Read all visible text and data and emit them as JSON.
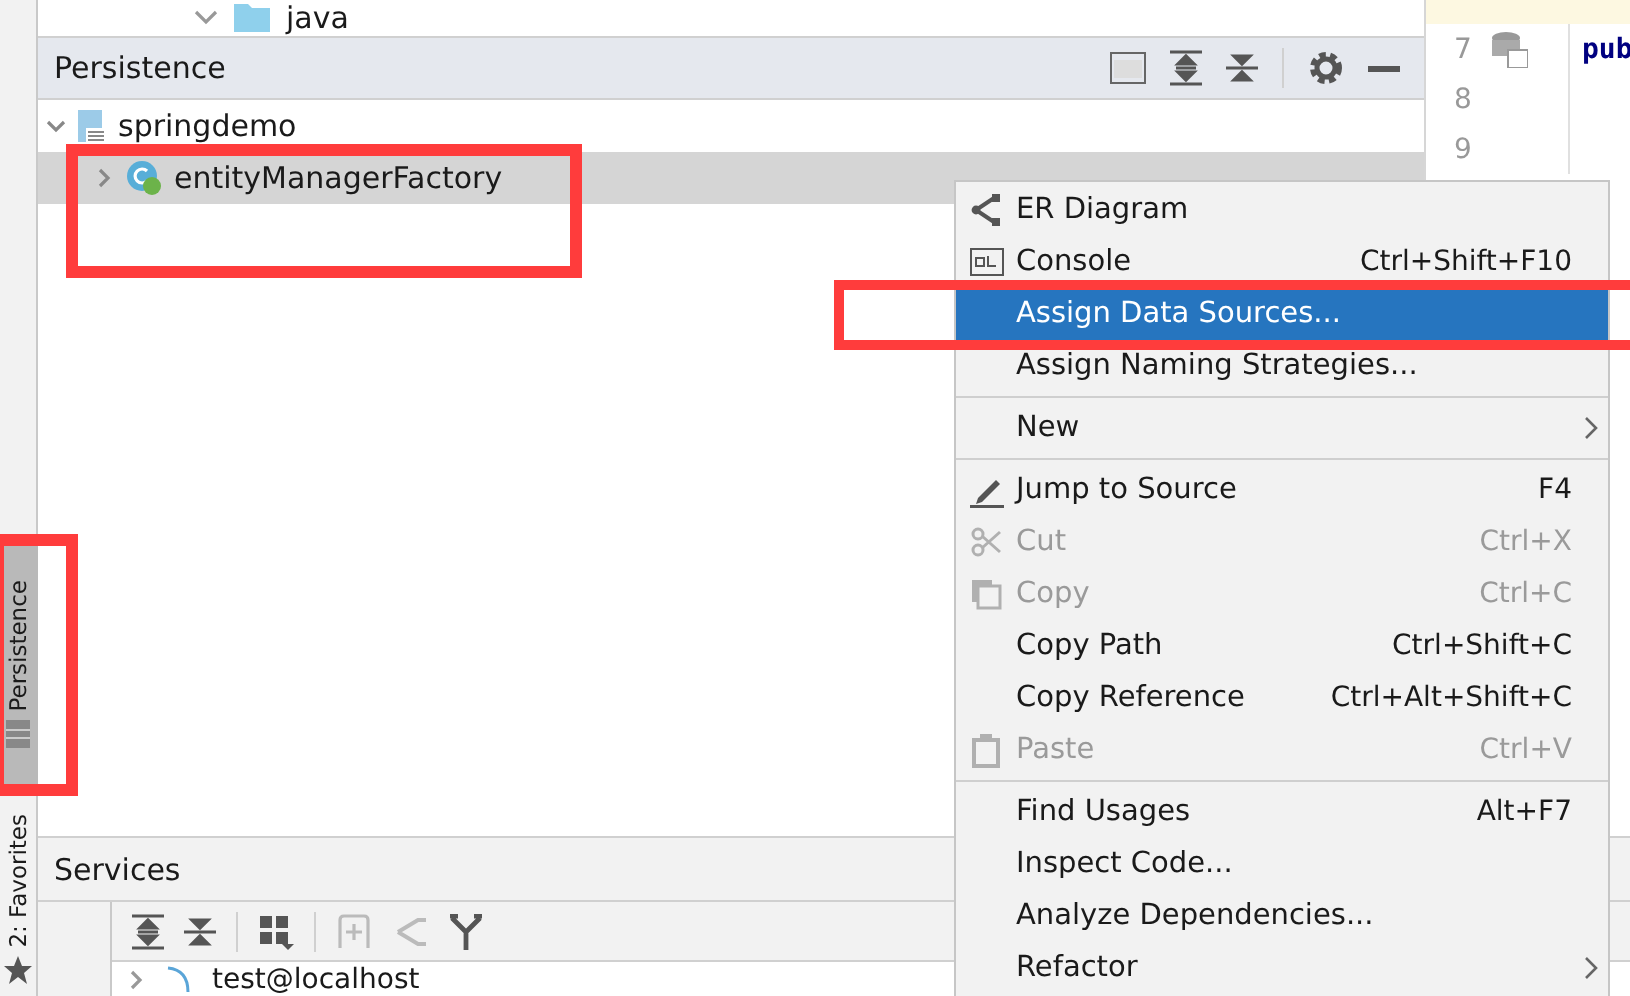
{
  "project_tree": {
    "folder": "java"
  },
  "persistence": {
    "title": "Persistence",
    "tree": [
      {
        "label": "springdemo",
        "expanded": true,
        "selected": false,
        "children": [
          {
            "label": "entityManagerFactory",
            "expanded": false,
            "selected": true
          }
        ]
      }
    ]
  },
  "editor": {
    "lines": [
      {
        "number": "7",
        "code": "pub"
      },
      {
        "number": "8"
      },
      {
        "number": "9"
      }
    ]
  },
  "side_tabs": [
    {
      "label": "Persistence",
      "selected": true
    },
    {
      "label": "2: Favorites",
      "selected": false
    }
  ],
  "services": {
    "title": "Services",
    "rows": [
      {
        "label": "test@localhost"
      }
    ]
  },
  "context_menu": {
    "items": [
      {
        "kind": "item",
        "label": "ER Diagram",
        "disabled": false,
        "selected": false,
        "submenu": false
      },
      {
        "kind": "item",
        "label": "Console",
        "shortcut": "Ctrl+Shift+F10",
        "disabled": false,
        "selected": false,
        "submenu": false
      },
      {
        "kind": "item",
        "label": "Assign Data Sources...",
        "disabled": false,
        "selected": true,
        "submenu": false
      },
      {
        "kind": "item",
        "label": "Assign Naming Strategies...",
        "disabled": false,
        "selected": false,
        "submenu": false
      },
      {
        "kind": "separator"
      },
      {
        "kind": "item",
        "label": "New",
        "disabled": false,
        "selected": false,
        "submenu": true
      },
      {
        "kind": "separator"
      },
      {
        "kind": "item",
        "label": "Jump to Source",
        "shortcut": "F4",
        "disabled": false,
        "selected": false,
        "submenu": false
      },
      {
        "kind": "item",
        "label": "Cut",
        "shortcut": "Ctrl+X",
        "disabled": true,
        "selected": false,
        "submenu": false
      },
      {
        "kind": "item",
        "label": "Copy",
        "shortcut": "Ctrl+C",
        "disabled": true,
        "selected": false,
        "submenu": false
      },
      {
        "kind": "item",
        "label": "Copy Path",
        "shortcut": "Ctrl+Shift+C",
        "disabled": false,
        "selected": false,
        "submenu": false
      },
      {
        "kind": "item",
        "label": "Copy Reference",
        "shortcut": "Ctrl+Alt+Shift+C",
        "disabled": false,
        "selected": false,
        "submenu": false
      },
      {
        "kind": "item",
        "label": "Paste",
        "shortcut": "Ctrl+V",
        "disabled": true,
        "selected": false,
        "submenu": false
      },
      {
        "kind": "separator"
      },
      {
        "kind": "item",
        "label": "Find Usages",
        "shortcut": "Alt+F7",
        "disabled": false,
        "selected": false,
        "submenu": false
      },
      {
        "kind": "item",
        "label": "Inspect Code...",
        "disabled": false,
        "selected": false,
        "submenu": false
      },
      {
        "kind": "item",
        "label": "Analyze Dependencies...",
        "disabled": false,
        "selected": false,
        "submenu": false
      },
      {
        "kind": "item",
        "label": "Refactor",
        "disabled": false,
        "selected": false,
        "submenu": true
      }
    ]
  }
}
